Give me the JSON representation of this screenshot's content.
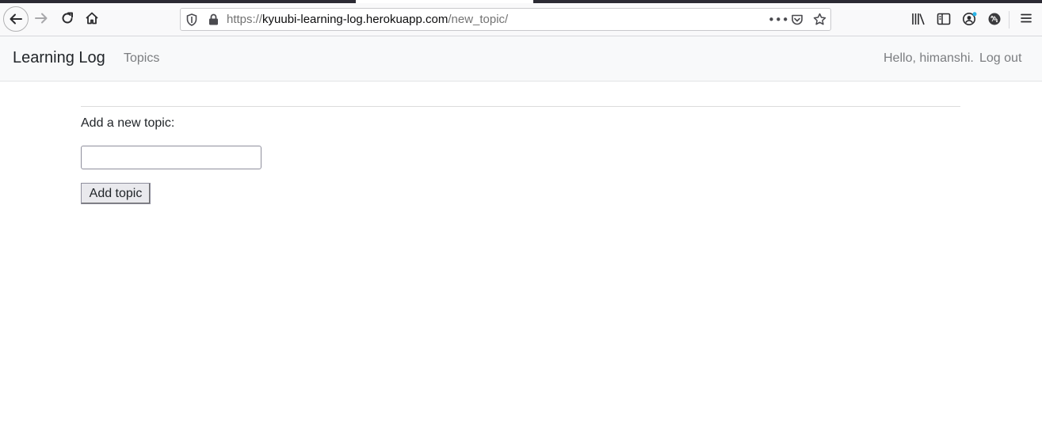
{
  "browser": {
    "url_prefix": "https://",
    "url_host": "kyuubi-learning-log.herokuapp.com",
    "url_path": "/new_topic/",
    "more_label": "•••"
  },
  "navbar": {
    "brand": "Learning Log",
    "topics_link": "Topics",
    "greeting": "Hello, himanshi.",
    "logout_link": "Log out"
  },
  "form": {
    "label": "Add a new topic:",
    "input_value": "",
    "submit_label": "Add topic"
  },
  "colors": {
    "navbar_bg": "#f8f9fa",
    "brand_text": "#212529",
    "nav_link": "#7b7d80"
  }
}
